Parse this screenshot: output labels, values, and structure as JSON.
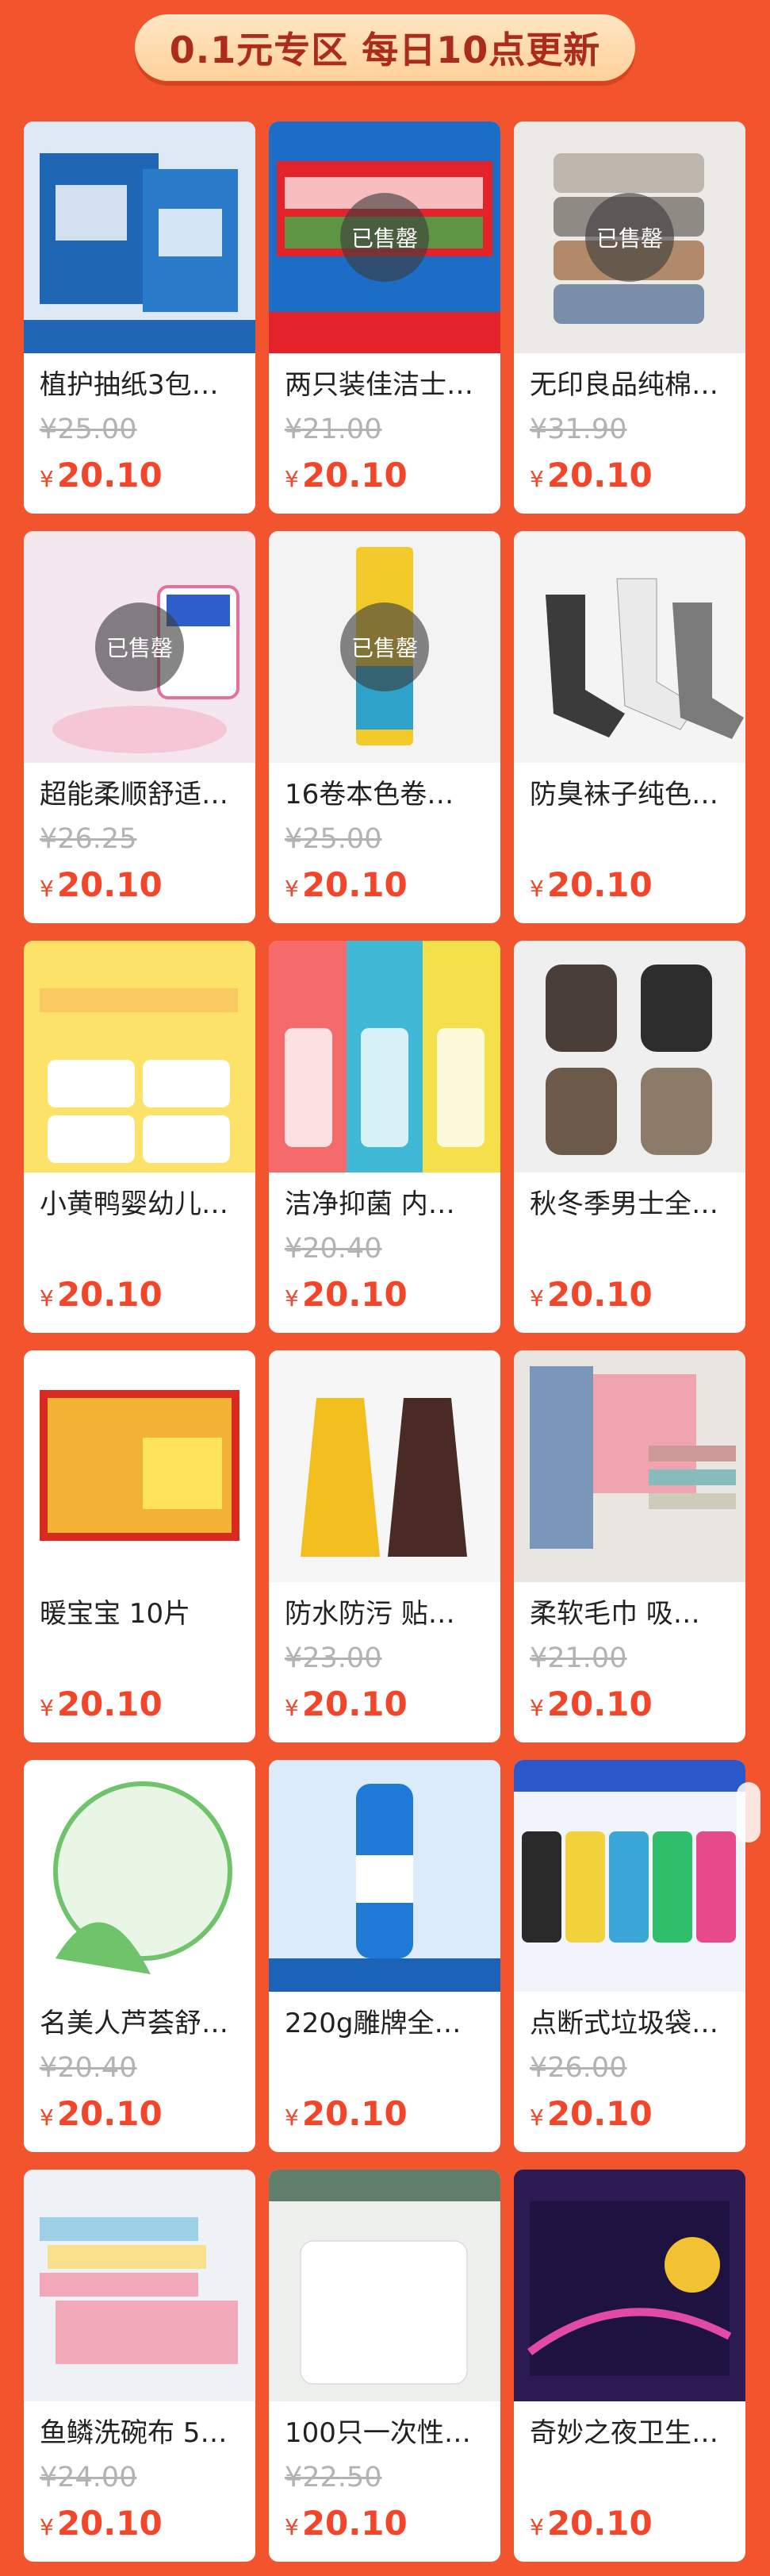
{
  "header": {
    "title": "0.1元专区  每日10点更新"
  },
  "labels": {
    "sold_out": "已售罄",
    "currency": "¥"
  },
  "products": [
    {
      "name": "植护抽纸3包…",
      "orig": "¥25.00",
      "price": "20.10",
      "sold": false,
      "thumb": "tissue",
      "colors": [
        "#dfe9f6",
        "#1f66b4"
      ]
    },
    {
      "name": "两只装佳洁士…",
      "orig": "¥21.00",
      "price": "20.10",
      "sold": true,
      "thumb": "toothpaste",
      "colors": [
        "#1b6dc6",
        "#e3222a"
      ]
    },
    {
      "name": "无印良品纯棉…",
      "orig": "¥31.90",
      "price": "20.10",
      "sold": true,
      "thumb": "towels",
      "colors": [
        "#eceae6",
        "#8a8a86"
      ]
    },
    {
      "name": "超能柔顺舒适…",
      "orig": "¥26.25",
      "price": "20.10",
      "sold": true,
      "thumb": "softener",
      "colors": [
        "#f4e8ee",
        "#e76f9c"
      ]
    },
    {
      "name": "16卷本色卷…",
      "orig": "¥25.00",
      "price": "20.10",
      "sold": true,
      "thumb": "paper-roll",
      "colors": [
        "#f3f3f3",
        "#f2cb2a"
      ]
    },
    {
      "name": "防臭袜子纯色…",
      "orig": "",
      "price": "20.10",
      "sold": false,
      "thumb": "socks",
      "colors": [
        "#f4f4f4",
        "#3b3b3b"
      ]
    },
    {
      "name": "小黄鸭婴幼儿…",
      "orig": "",
      "price": "20.10",
      "sold": false,
      "thumb": "wipes",
      "colors": [
        "#fde26a",
        "#e5332a"
      ]
    },
    {
      "name": "洁净抑菌 内…",
      "orig": "¥20.40",
      "price": "20.10",
      "sold": false,
      "thumb": "bottles",
      "colors": [
        "#f4f4f4",
        "#e23b3b"
      ]
    },
    {
      "name": "秋冬季男士全…",
      "orig": "",
      "price": "20.10",
      "sold": false,
      "thumb": "gloves",
      "colors": [
        "#efefef",
        "#4a3f38"
      ]
    },
    {
      "name": "暖宝宝 10片",
      "orig": "",
      "price": "20.10",
      "sold": false,
      "thumb": "warmer",
      "colors": [
        "#ffffff",
        "#d82a1e"
      ]
    },
    {
      "name": "防水防污 贴…",
      "orig": "¥23.00",
      "price": "20.10",
      "sold": false,
      "thumb": "aprons",
      "colors": [
        "#f6f6f6",
        "#f2bf1f"
      ]
    },
    {
      "name": "柔软毛巾 吸…",
      "orig": "¥21.00",
      "price": "20.10",
      "sold": false,
      "thumb": "towel-rack",
      "colors": [
        "#e9e6e2",
        "#f0a4b0"
      ]
    },
    {
      "name": "名美人芦荟舒…",
      "orig": "¥20.40",
      "price": "20.10",
      "sold": false,
      "thumb": "aloe",
      "colors": [
        "#ffffff",
        "#6fc36a"
      ]
    },
    {
      "name": "220g雕牌全…",
      "orig": "",
      "price": "20.10",
      "sold": false,
      "thumb": "detergent",
      "colors": [
        "#dcebfa",
        "#1f7ad6"
      ]
    },
    {
      "name": "点断式垃圾袋…",
      "orig": "¥26.00",
      "price": "20.10",
      "sold": false,
      "thumb": "trash-bags",
      "colors": [
        "#f2f4fb",
        "#2b57c8"
      ]
    },
    {
      "name": "鱼鳞洗碗布 5…",
      "orig": "¥24.00",
      "price": "20.10",
      "sold": false,
      "thumb": "cloths",
      "colors": [
        "#eef1f5",
        "#f2a8b8"
      ]
    },
    {
      "name": "100只一次性…",
      "orig": "¥22.50",
      "price": "20.10",
      "sold": false,
      "thumb": "covers",
      "colors": [
        "#eef0ee",
        "#5f7f6a"
      ]
    },
    {
      "name": "奇妙之夜卫生…",
      "orig": "",
      "price": "20.10",
      "sold": false,
      "thumb": "pads",
      "colors": [
        "#2b1a53",
        "#e24aa8"
      ]
    }
  ]
}
